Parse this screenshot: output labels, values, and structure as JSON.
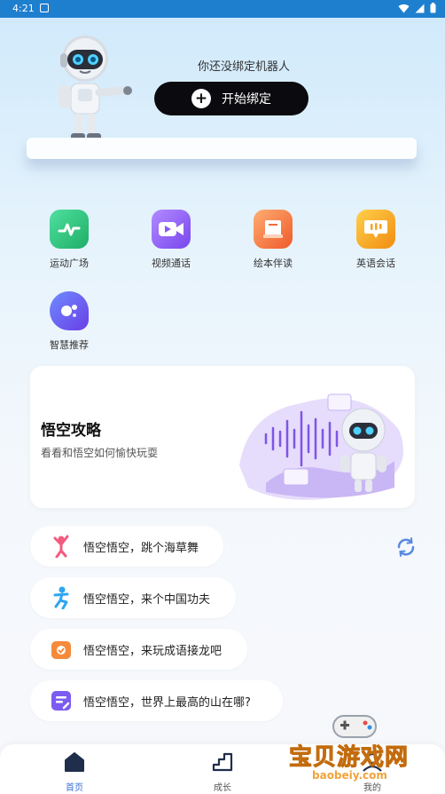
{
  "status_bar": {
    "time": "4:21"
  },
  "hero": {
    "hint": "你还没绑定机器人",
    "bind_button": {
      "icon": "plus-icon",
      "label": "开始绑定"
    }
  },
  "features": [
    {
      "label": "运动广场",
      "icon": "activity-icon",
      "color": "#2fc07a"
    },
    {
      "label": "视频通话",
      "icon": "video-call-icon",
      "color": "#8a5cf0"
    },
    {
      "label": "绘本伴读",
      "icon": "picture-book-icon",
      "color": "#f46a3c"
    },
    {
      "label": "英语会话",
      "icon": "chat-icon",
      "color": "#f5a31f"
    },
    {
      "label": "智慧推荐",
      "icon": "smart-recommend-icon",
      "color": "#7b5cf5"
    }
  ],
  "guide": {
    "title": "悟空攻略",
    "subtitle": "看看和悟空如何愉快玩耍"
  },
  "commands": [
    {
      "text": "悟空悟空，跳个海草舞",
      "icon": "dance-icon",
      "color": "#f25b7e"
    },
    {
      "text": "悟空悟空，来个中国功夫",
      "icon": "kungfu-icon",
      "color": "#2fa6f0"
    },
    {
      "text": "悟空悟空，来玩成语接龙吧",
      "icon": "idiom-game-icon",
      "color": "#f58a3a"
    },
    {
      "text": "悟空悟空，世界上最高的山在哪?",
      "icon": "question-icon",
      "color": "#7c5cf0"
    }
  ],
  "tabs": [
    {
      "label": "首页",
      "icon": "home-icon",
      "active": true
    },
    {
      "label": "成长",
      "icon": "growth-icon",
      "active": false
    },
    {
      "label": "我的",
      "icon": "profile-icon",
      "active": false
    }
  ],
  "watermark": {
    "text": "宝贝游戏网",
    "url": "baobeiy.com"
  },
  "colors": {
    "accent": "#3a6fd8",
    "button_bg": "#0b0b0f",
    "status_bar": "#1f7fcf"
  }
}
